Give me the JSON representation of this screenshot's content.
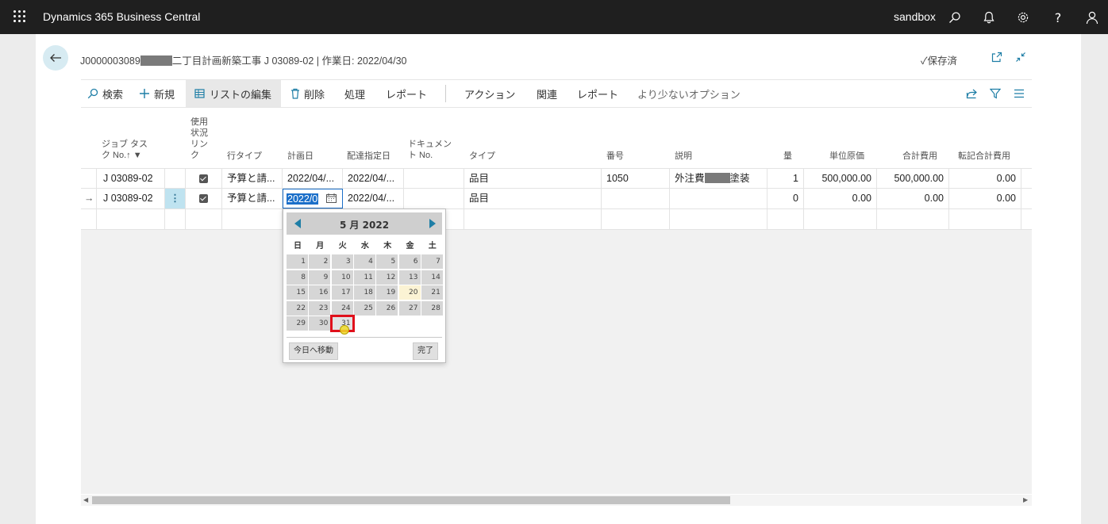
{
  "topbar": {
    "app_title": "Dynamics 365 Business Central",
    "environment": "sandbox"
  },
  "header": {
    "title_prefix": "J0000003089",
    "title_suffix": "二丁目計画新築工事 J 03089-02 | 作業日: 2022/04/30",
    "saved_status": "保存済"
  },
  "actions": {
    "search": "検索",
    "new": "新規",
    "edit_list": "リストの編集",
    "delete": "削除",
    "process": "処理",
    "report1": "レポート",
    "action": "アクション",
    "related": "関連",
    "report2": "レポート",
    "fewer_options": "より少ないオプション"
  },
  "columns": {
    "job_task_no": "ジョブ タス\nク No.↑",
    "usage_link": "使用\n状況\nリン\nク",
    "line_type": "行タイプ",
    "planning_date": "計画日",
    "planned_delivery": "配達指定日",
    "document_no": "ドキュメン\nト No.",
    "type": "タイプ",
    "number": "番号",
    "description": "説明",
    "quantity": "量",
    "unit_cost": "単位原価",
    "total_cost": "合計費用",
    "transfer_total": "転記合計費用"
  },
  "rows": [
    {
      "job_task_no": "J 03089-02",
      "line_type": "予算と請...",
      "planning_date": "2022/04/...",
      "planned_delivery": "2022/04/...",
      "type": "品目",
      "number": "1050",
      "description_a": "外注費",
      "description_b": "塗装",
      "quantity": "1",
      "unit_cost": "500,000.00",
      "total_cost": "500,000.00",
      "transfer_total": "0.00"
    },
    {
      "job_task_no": "J 03089-02",
      "line_type": "予算と請...",
      "planning_date": "2022/0",
      "planned_delivery": "2022/04/...",
      "type": "品目",
      "number": "",
      "description_a": "",
      "description_b": "",
      "quantity": "0",
      "unit_cost": "0.00",
      "total_cost": "0.00",
      "transfer_total": "0.00"
    }
  ],
  "datepicker": {
    "title": "5 月 2022",
    "weekdays": [
      "日",
      "月",
      "火",
      "水",
      "木",
      "金",
      "土"
    ],
    "weeks": [
      [
        "1",
        "2",
        "3",
        "4",
        "5",
        "6",
        "7"
      ],
      [
        "8",
        "9",
        "10",
        "11",
        "12",
        "13",
        "14"
      ],
      [
        "15",
        "16",
        "17",
        "18",
        "19",
        "20",
        "21"
      ],
      [
        "22",
        "23",
        "24",
        "25",
        "26",
        "27",
        "28"
      ],
      [
        "29",
        "30",
        "31"
      ]
    ],
    "today_day": "20",
    "highlighted_day": "31",
    "go_today": "今日へ移動",
    "done": "完了"
  }
}
